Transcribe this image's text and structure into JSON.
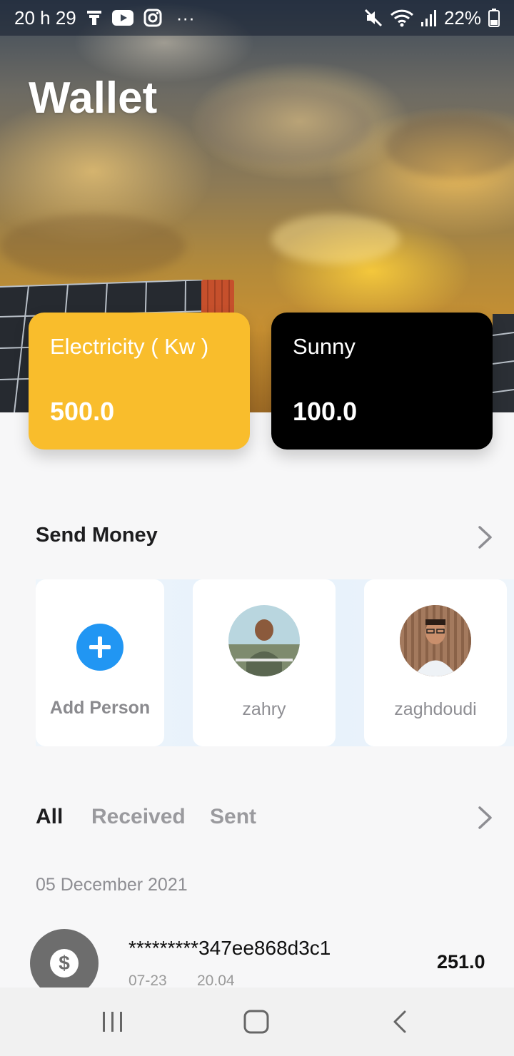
{
  "status_bar": {
    "time": "20 h 29",
    "battery": "22%",
    "more": "···"
  },
  "header": {
    "title": "Wallet"
  },
  "cards": [
    {
      "label": "Electricity ( Kw )",
      "value": "500.0",
      "color": "#f9bd2c"
    },
    {
      "label": "Sunny",
      "value": "100.0",
      "color": "#000000"
    }
  ],
  "send_money": {
    "title": "Send Money",
    "add_label": "Add Person",
    "people": [
      {
        "name": "zahry",
        "icon": "person-avatar"
      },
      {
        "name": "zaghdoudi",
        "icon": "person-avatar"
      }
    ]
  },
  "transactions": {
    "tabs": [
      "All",
      "Received",
      "Sent"
    ],
    "active_tab": "All",
    "date": "05 December 2021",
    "items": [
      {
        "id": "*********347ee868d3c1",
        "date": "07-23",
        "time": "20.04",
        "amount": "251.0",
        "icon": "dollar-icon"
      }
    ]
  },
  "colors": {
    "accent_blue": "#2196f3",
    "yellow": "#f9bd2c",
    "muted_text": "#8e8e93"
  }
}
